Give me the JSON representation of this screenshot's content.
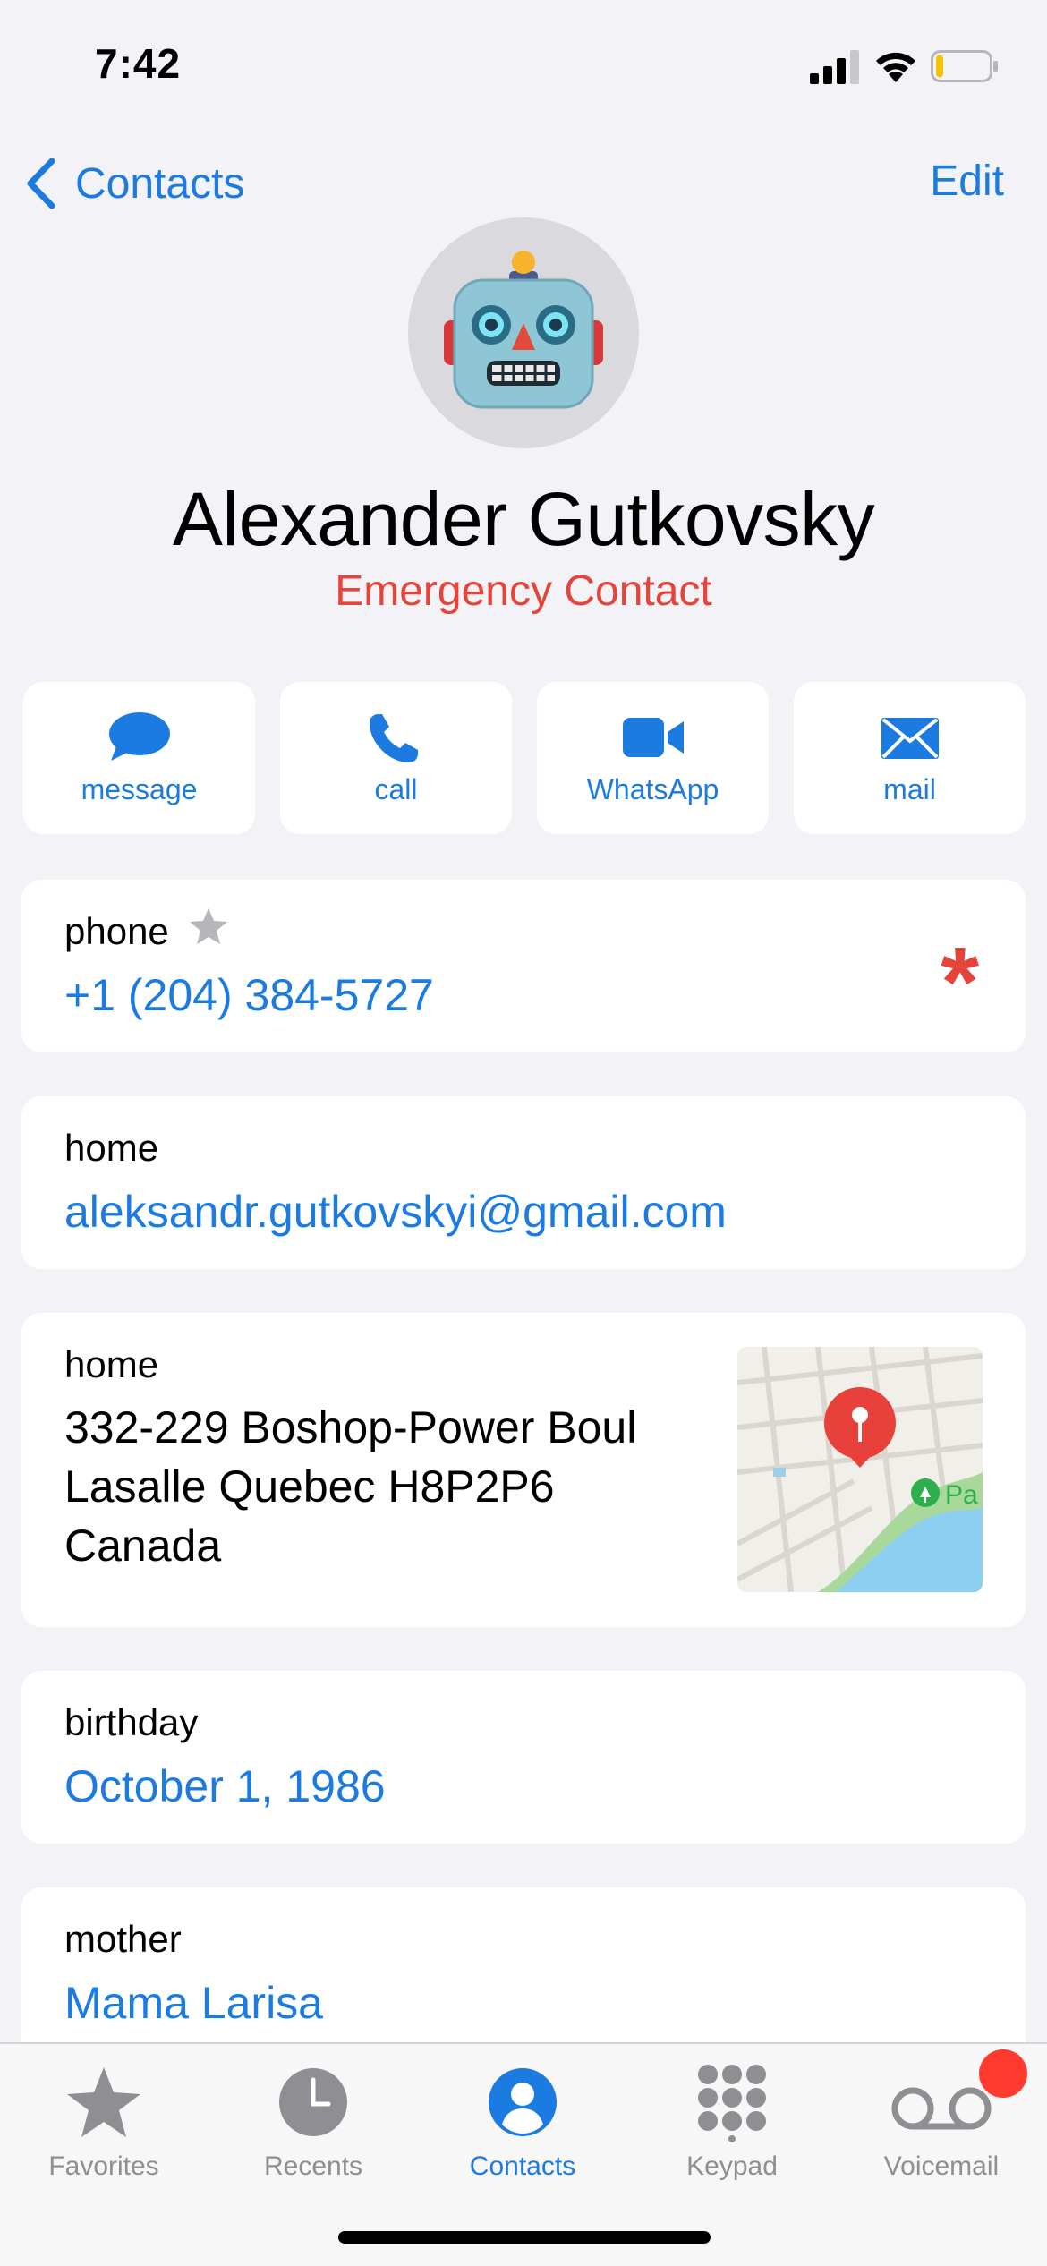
{
  "status_bar": {
    "time": "7:42"
  },
  "nav": {
    "back_label": "Contacts",
    "edit_label": "Edit"
  },
  "contact": {
    "name": "Alexander Gutkovsky",
    "subtitle": "Emergency Contact"
  },
  "actions": [
    {
      "label": "message",
      "icon": "message-bubble-icon"
    },
    {
      "label": "call",
      "icon": "phone-icon"
    },
    {
      "label": "WhatsApp",
      "icon": "video-icon"
    },
    {
      "label": "mail",
      "icon": "envelope-icon"
    }
  ],
  "fields": {
    "phone": {
      "label": "phone",
      "value": "+1 (204) 384-5727",
      "favorite": true,
      "emergency": true
    },
    "email": {
      "label": "home",
      "value": "aleksandr.gutkovskyi@gmail.com"
    },
    "address": {
      "label": "home",
      "lines": [
        "332-229 Boshop-Power Boul",
        "Lasalle Quebec H8P2P6",
        "Canada"
      ],
      "map_label": "Pa"
    },
    "birthday": {
      "label": "birthday",
      "value": "October 1, 1986"
    },
    "relation": {
      "label": "mother",
      "value": "Mama Larisa"
    }
  },
  "tabs": [
    {
      "label": "Favorites",
      "icon": "star-icon",
      "active": false
    },
    {
      "label": "Recents",
      "icon": "clock-icon",
      "active": false
    },
    {
      "label": "Contacts",
      "icon": "person-circle-icon",
      "active": true
    },
    {
      "label": "Keypad",
      "icon": "keypad-icon",
      "active": false
    },
    {
      "label": "Voicemail",
      "icon": "voicemail-icon",
      "active": false
    }
  ],
  "colors": {
    "accent": "#1C7BE0",
    "destructive": "#E5443A",
    "background": "#F2F2F7",
    "inactive": "#8E8E93"
  }
}
